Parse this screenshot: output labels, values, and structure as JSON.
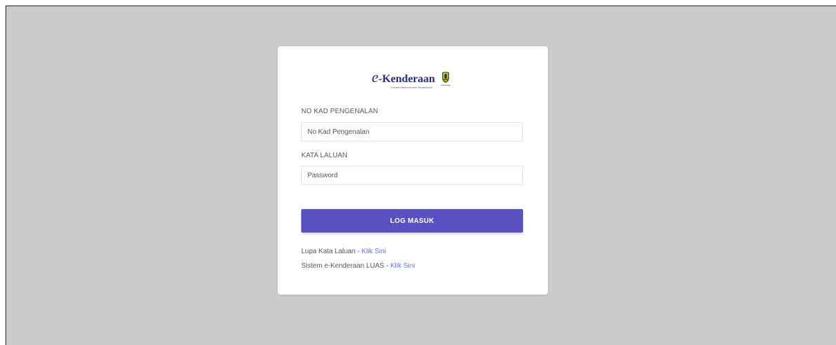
{
  "logo": {
    "prefix": "e",
    "name": "-Kenderaan",
    "tagline": "SISTEM PENGURUSAN KENDERAAN"
  },
  "login": {
    "ic_label": "NO KAD PENGENALAN",
    "ic_placeholder": "No Kad Pengenalan",
    "password_label": "KATA LALUAN",
    "password_placeholder": "Password",
    "submit_label": "LOG MASUK"
  },
  "links": [
    {
      "text": "Lupa Kata Laluan",
      "separator": " - ",
      "link": "Klik Sini"
    },
    {
      "text": "Sistem e-Kenderaan LUAS",
      "separator": " - ",
      "link": "Klik Sini"
    }
  ],
  "colors": {
    "page_background": "#cccccc",
    "button": "#5b4fc4",
    "link": "#5e72e4",
    "logo": "#2b2a7a"
  }
}
